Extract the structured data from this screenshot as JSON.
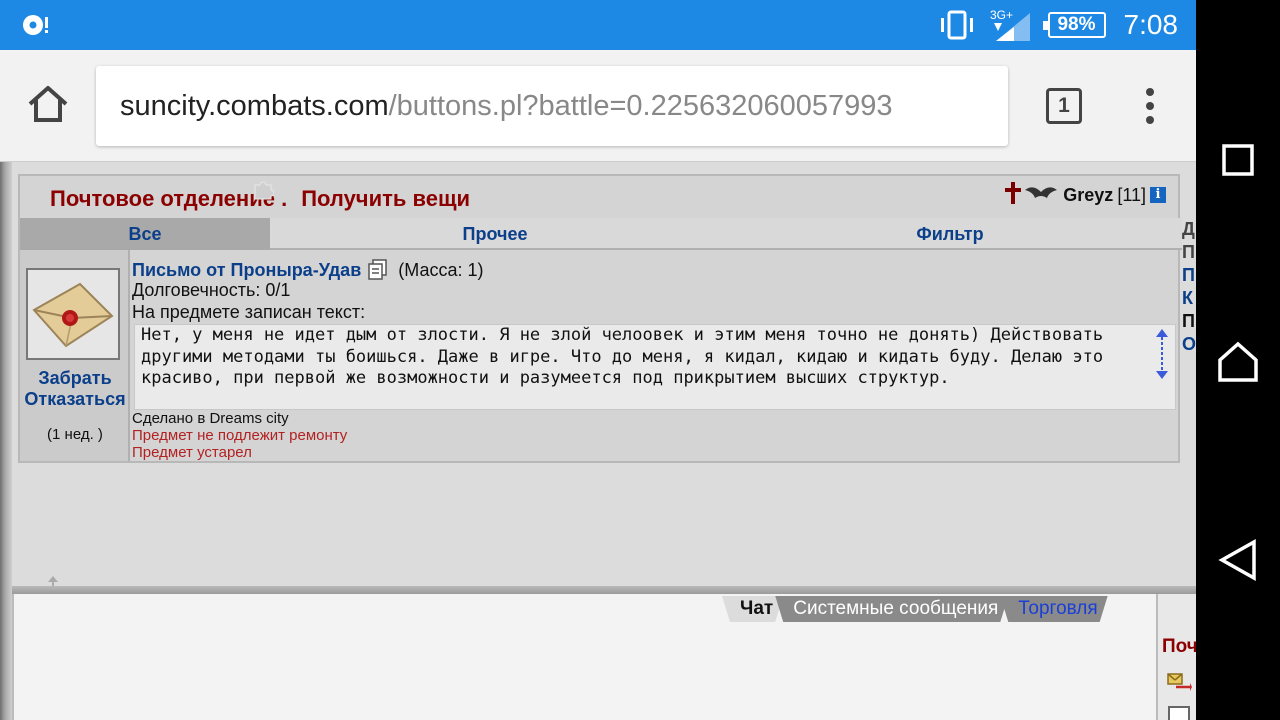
{
  "status_bar": {
    "network": "3G+",
    "battery": "98%",
    "time": "7:08",
    "icons": [
      "notification-icon",
      "vibrate-icon",
      "signal-icon"
    ]
  },
  "browser": {
    "url_host": "suncity.combats.com",
    "url_path": "/buttons.pl?battle=0.225632060057993",
    "tab_count": "1"
  },
  "panel": {
    "title": "Почтовое отделение .",
    "subtitle": "Получить вещи",
    "user_name": "Greyz",
    "user_level": "[11]",
    "info_glyph": "i"
  },
  "tabs": [
    {
      "label": "Все"
    },
    {
      "label": "Прочее"
    },
    {
      "label": "Фильтр"
    }
  ],
  "item": {
    "name": "Письмо от Проныра-Удав",
    "mass": "(Масса: 1)",
    "durability": "Долговечность: 0/1",
    "text_label": "На предмете записан текст:",
    "letter_text": "Нет, у меня не идет дым от злости. Я не злой челоовек и этим меня точно не донять) Действовать другими методами ты боишься. Даже в игре. Что до меня, я кидал, кидаю и кидать буду. Делаю это красиво, при первой же возможности и разумеется под прикрытием высших структур.",
    "made_in": "Сделано в Dreams city",
    "no_repair": "Предмет не подлежит ремонту",
    "expired": "Предмет устарел",
    "take_label": "Забрать",
    "refuse_label": "Отказаться",
    "age": "(1 нед. )"
  },
  "side_strip": [
    "Д",
    "П",
    "",
    "П",
    "К",
    "П",
    "",
    "О"
  ],
  "chat": {
    "tabs": [
      "Чат",
      "Системные сообщения",
      "Торговля"
    ],
    "right_title": "Почта"
  }
}
